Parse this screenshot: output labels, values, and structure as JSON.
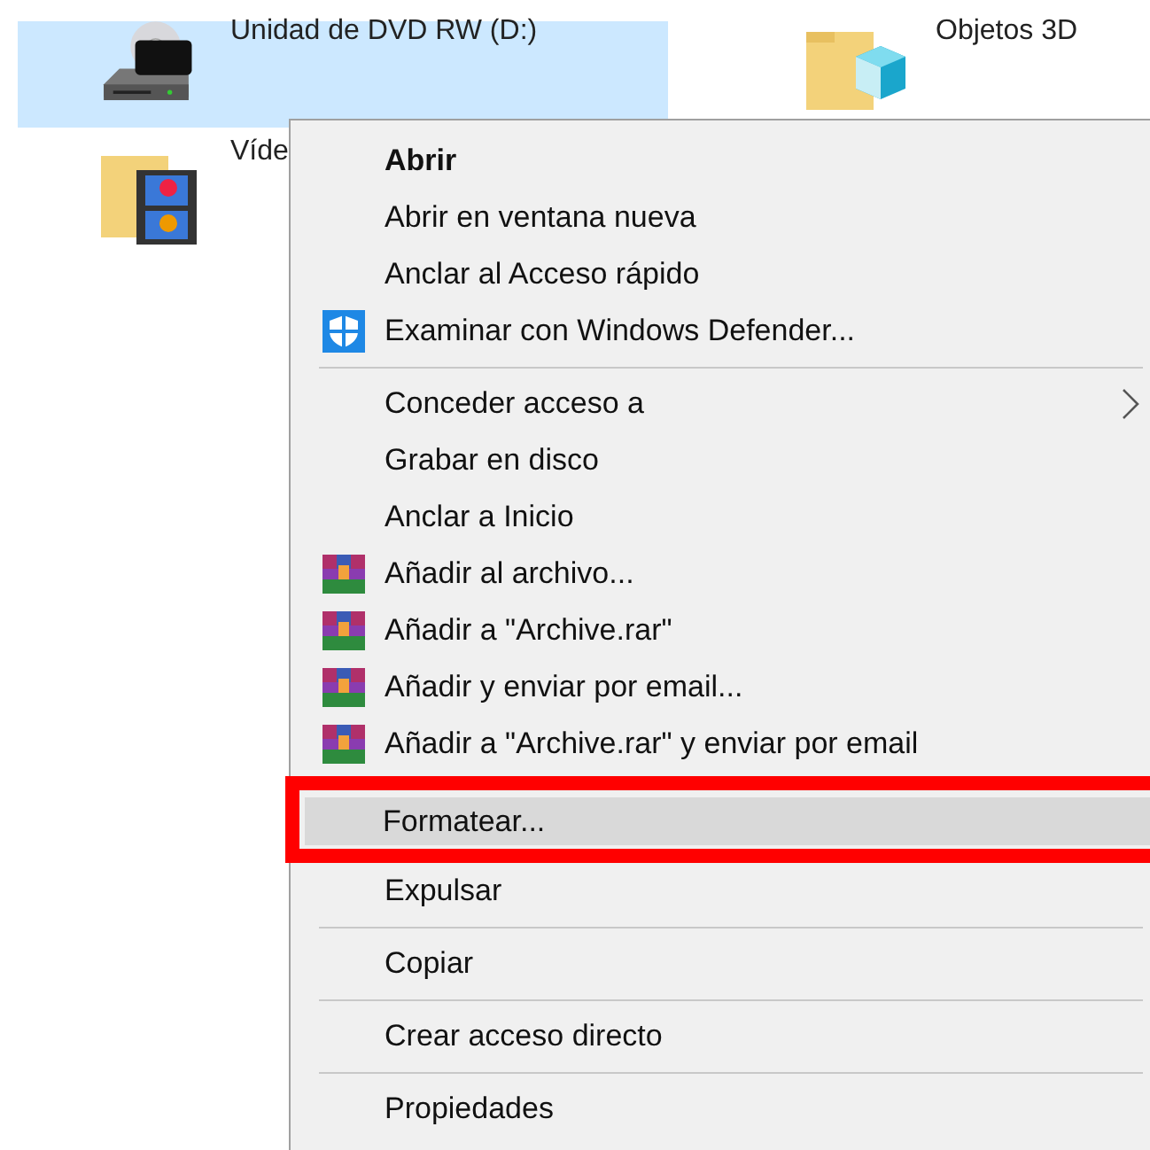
{
  "items": [
    {
      "label": "Unidad de DVD RW (D:)",
      "kind": "dvd",
      "selected": true
    },
    {
      "label": "Objetos 3D",
      "kind": "objects3d",
      "selected": false
    },
    {
      "label": "Víde",
      "kind": "videos",
      "selected": false
    }
  ],
  "context_menu": {
    "items": [
      {
        "kind": "plain",
        "label": "Abrir",
        "default": true,
        "selected": false,
        "outlined": false
      },
      {
        "kind": "plain",
        "label": "Abrir en ventana nueva",
        "default": false,
        "selected": false,
        "outlined": false
      },
      {
        "kind": "plain",
        "label": "Anclar al Acceso rápido",
        "default": false,
        "selected": false,
        "outlined": false
      },
      {
        "kind": "defender",
        "label": "Examinar con Windows Defender...",
        "default": false,
        "selected": false,
        "outlined": false
      },
      {
        "kind": "separator"
      },
      {
        "kind": "plain",
        "label": "Conceder acceso a",
        "default": false,
        "submenu": true,
        "selected": false,
        "outlined": false
      },
      {
        "kind": "plain",
        "label": "Grabar en disco",
        "default": false,
        "selected": false,
        "outlined": false
      },
      {
        "kind": "plain",
        "label": "Anclar a Inicio",
        "default": false,
        "selected": false,
        "outlined": false
      },
      {
        "kind": "archiver",
        "label": "Añadir al archivo...",
        "default": false,
        "selected": false,
        "outlined": false
      },
      {
        "kind": "archiver",
        "label": "Añadir a \"Archive.rar\"",
        "default": false,
        "selected": false,
        "outlined": false
      },
      {
        "kind": "archiver",
        "label": "Añadir y enviar por email...",
        "default": false,
        "selected": false,
        "outlined": false
      },
      {
        "kind": "archiver",
        "label": "Añadir a \"Archive.rar\" y enviar por email",
        "default": false,
        "selected": false,
        "outlined": false
      },
      {
        "kind": "plain",
        "label": "Formatear...",
        "default": false,
        "selected": true,
        "outlined": true
      },
      {
        "kind": "plain",
        "label": "Expulsar",
        "default": false,
        "selected": false,
        "outlined": false
      },
      {
        "kind": "separator"
      },
      {
        "kind": "plain",
        "label": "Copiar",
        "default": false,
        "selected": false,
        "outlined": false
      },
      {
        "kind": "separator"
      },
      {
        "kind": "plain",
        "label": "Crear acceso directo",
        "default": false,
        "selected": false,
        "outlined": false
      },
      {
        "kind": "separator"
      },
      {
        "kind": "plain",
        "label": "Propiedades",
        "default": false,
        "selected": false,
        "outlined": false
      }
    ]
  }
}
